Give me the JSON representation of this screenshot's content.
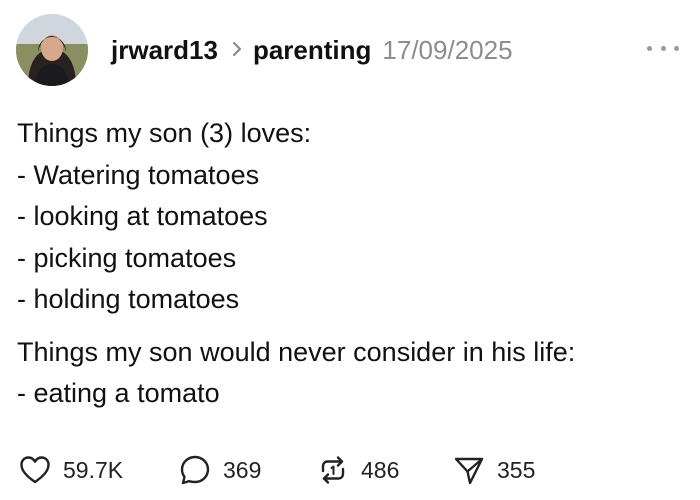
{
  "post": {
    "author": "jrward13",
    "community": "parenting",
    "date": "17/09/2025",
    "paragraphs": [
      [
        "Things my son (3) loves:",
        "- Watering tomatoes",
        "- looking at tomatoes",
        "- picking tomatoes",
        "- holding tomatoes"
      ],
      [
        "Things my son would never consider in his life:",
        "- eating a tomato"
      ]
    ]
  },
  "actions": {
    "likes": "59.7K",
    "replies": "369",
    "reposts": "486",
    "shares": "355"
  },
  "icons": {
    "like": "heart-icon",
    "reply": "speech-bubble-icon",
    "repost": "repost-arrows-icon",
    "share": "send-paper-plane-icon",
    "more": "more-options-icon",
    "separator": "chevron-right-icon"
  },
  "colors": {
    "text": "#111111",
    "muted": "#8d8d8d",
    "background": "#ffffff"
  }
}
